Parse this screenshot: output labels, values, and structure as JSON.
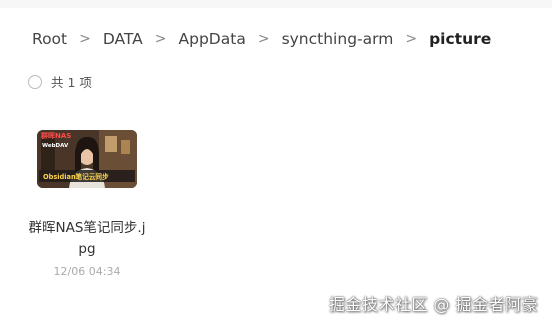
{
  "breadcrumb": {
    "items": [
      "Root",
      "DATA",
      "AppData",
      "syncthing-arm"
    ],
    "current": "picture",
    "separator": ">"
  },
  "summary": {
    "count_label": "共 1 项"
  },
  "files": [
    {
      "name": "群晖NAS笔记同步.jpg",
      "date": "12/06 04:34",
      "thumbnail": {
        "title_line1": "群晖NAS",
        "title_line2": "WebDAV",
        "caption": "Obsidian笔记云同步"
      }
    }
  ],
  "watermark": "掘金技术社区 @ 掘金者阿豪"
}
